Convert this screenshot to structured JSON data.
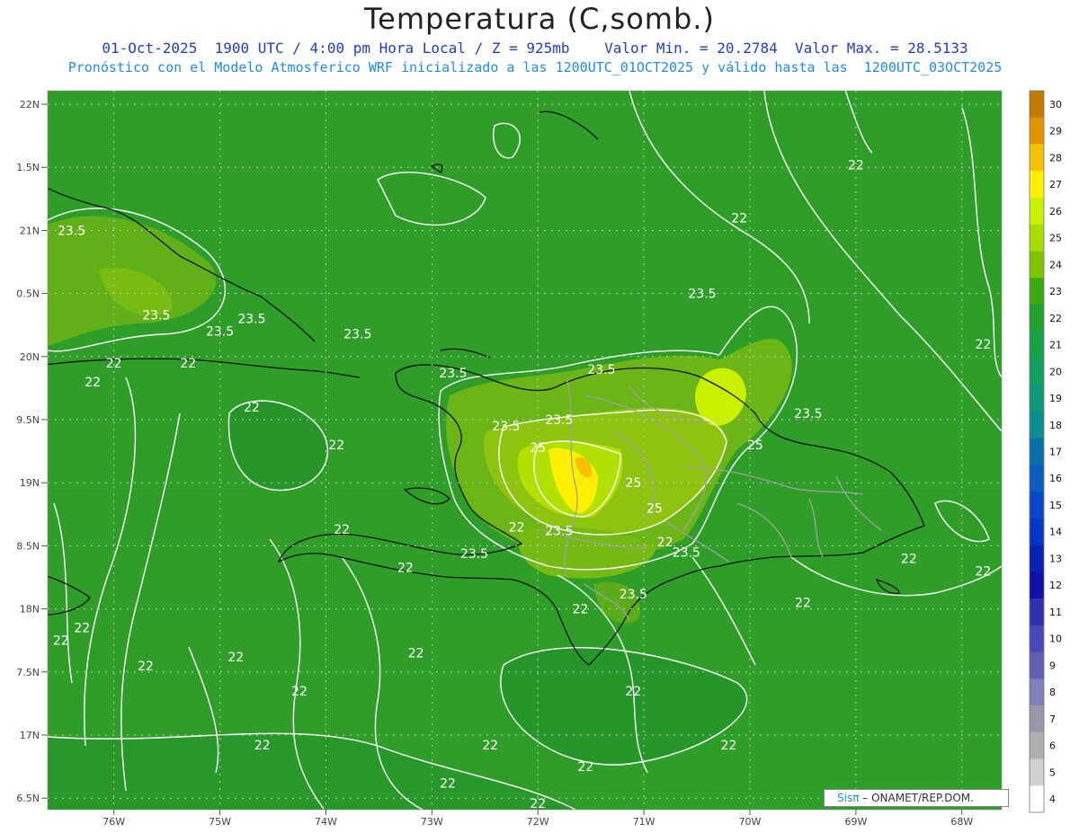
{
  "title": "Temperatura (C,somb.)",
  "subtitle1": "01-Oct-2025  1900 UTC / 4:00 pm Hora Local / Z = 925mb    Valor Min. = 20.2784  Valor Max. = 28.5133",
  "subtitle2": "Pronóstico con el Modelo Atmosferico WRF inicializado a las 1200UTC_01OCT2025 y válido hasta las  1200UTC_03OCT2025",
  "credit": {
    "sis": "Sisπ",
    "rest": "– ONAMET/REP.DOM."
  },
  "map": {
    "lat_labels": [
      "22N",
      "1.5N",
      "21N",
      "0.5N",
      "20N",
      "9.5N",
      "19N",
      "8.5N",
      "18N",
      "7.5N",
      "17N",
      "6.5N"
    ],
    "lon_labels": [
      "76W",
      "75W",
      "74W",
      "73W",
      "72W",
      "71W",
      "70W",
      "69W",
      "68W"
    ],
    "contour_labels": [
      {
        "text": "23.5",
        "lon": -76.4,
        "lat": 21.0
      },
      {
        "text": "23.5",
        "lon": -75.6,
        "lat": 20.33
      },
      {
        "text": "23.5",
        "lon": -74.7,
        "lat": 20.3
      },
      {
        "text": "23.5",
        "lon": -75.0,
        "lat": 20.2
      },
      {
        "text": "23.5",
        "lon": -73.7,
        "lat": 20.18
      },
      {
        "text": "22",
        "lon": -76.0,
        "lat": 19.95
      },
      {
        "text": "22",
        "lon": -75.3,
        "lat": 19.95
      },
      {
        "text": "22",
        "lon": -76.2,
        "lat": 19.8
      },
      {
        "text": "22",
        "lon": -74.7,
        "lat": 19.6
      },
      {
        "text": "22",
        "lon": -73.9,
        "lat": 19.3
      },
      {
        "text": "23.5",
        "lon": -72.8,
        "lat": 19.87
      },
      {
        "text": "23.5",
        "lon": -72.3,
        "lat": 19.45
      },
      {
        "text": "23.5",
        "lon": -71.8,
        "lat": 19.5
      },
      {
        "text": "23.5",
        "lon": -71.4,
        "lat": 19.9
      },
      {
        "text": "25",
        "lon": -72.0,
        "lat": 19.28
      },
      {
        "text": "25",
        "lon": -71.1,
        "lat": 19.0
      },
      {
        "text": "25",
        "lon": -70.9,
        "lat": 18.8
      },
      {
        "text": "25",
        "lon": -69.95,
        "lat": 19.3
      },
      {
        "text": "23.5",
        "lon": -70.45,
        "lat": 20.5
      },
      {
        "text": "23.5",
        "lon": -69.45,
        "lat": 19.55
      },
      {
        "text": "22",
        "lon": -72.2,
        "lat": 18.65
      },
      {
        "text": "23.5",
        "lon": -71.8,
        "lat": 18.62
      },
      {
        "text": "23.5",
        "lon": -72.6,
        "lat": 18.44
      },
      {
        "text": "22",
        "lon": -73.85,
        "lat": 18.63
      },
      {
        "text": "22",
        "lon": -73.25,
        "lat": 18.33
      },
      {
        "text": "23.5",
        "lon": -70.6,
        "lat": 18.45
      },
      {
        "text": "22",
        "lon": -70.8,
        "lat": 18.53
      },
      {
        "text": "23.5",
        "lon": -71.1,
        "lat": 18.12
      },
      {
        "text": "22",
        "lon": -71.6,
        "lat": 18.0
      },
      {
        "text": "22",
        "lon": -69.5,
        "lat": 18.05
      },
      {
        "text": "22",
        "lon": -68.5,
        "lat": 18.4
      },
      {
        "text": "22",
        "lon": -67.8,
        "lat": 18.3
      },
      {
        "text": "22",
        "lon": -69.0,
        "lat": 21.52
      },
      {
        "text": "22",
        "lon": -70.1,
        "lat": 21.1
      },
      {
        "text": "22",
        "lon": -67.8,
        "lat": 20.1
      },
      {
        "text": "22",
        "lon": -75.7,
        "lat": 17.55
      },
      {
        "text": "22",
        "lon": -76.5,
        "lat": 17.75
      },
      {
        "text": "22",
        "lon": -76.3,
        "lat": 17.85
      },
      {
        "text": "22",
        "lon": -74.85,
        "lat": 17.62
      },
      {
        "text": "22",
        "lon": -73.15,
        "lat": 17.65
      },
      {
        "text": "22",
        "lon": -71.1,
        "lat": 17.35
      },
      {
        "text": "22",
        "lon": -74.25,
        "lat": 17.35
      },
      {
        "text": "22",
        "lon": -74.6,
        "lat": 16.92
      },
      {
        "text": "22",
        "lon": -72.45,
        "lat": 16.92
      },
      {
        "text": "22",
        "lon": -71.55,
        "lat": 16.75
      },
      {
        "text": "22",
        "lon": -70.2,
        "lat": 16.92
      },
      {
        "text": "22",
        "lon": -72.85,
        "lat": 16.62
      },
      {
        "text": "22",
        "lon": -72.0,
        "lat": 16.46
      }
    ]
  },
  "colorbar": {
    "labels": [
      "30",
      "29",
      "28",
      "27",
      "26",
      "25",
      "24",
      "23",
      "22",
      "21",
      "20",
      "19",
      "18",
      "17",
      "16",
      "15",
      "14",
      "13",
      "12",
      "11",
      "10",
      "9",
      "8",
      "7",
      "6",
      "5",
      "4"
    ],
    "colors": [
      "#c27a00",
      "#e09500",
      "#f5c000",
      "#fff000",
      "#c8f000",
      "#a6dc00",
      "#80c400",
      "#3aaa10",
      "#22a030",
      "#18a048",
      "#15a060",
      "#109878",
      "#0f8c8c",
      "#0a70a8",
      "#0a5cc0",
      "#0848c8",
      "#0834c8",
      "#0a20b0",
      "#1010a8",
      "#3030b0",
      "#4848b8",
      "#6060b0",
      "#8080b8",
      "#9898a8",
      "#b0b0b0",
      "#d0d0d0",
      "#ffffff"
    ]
  }
}
